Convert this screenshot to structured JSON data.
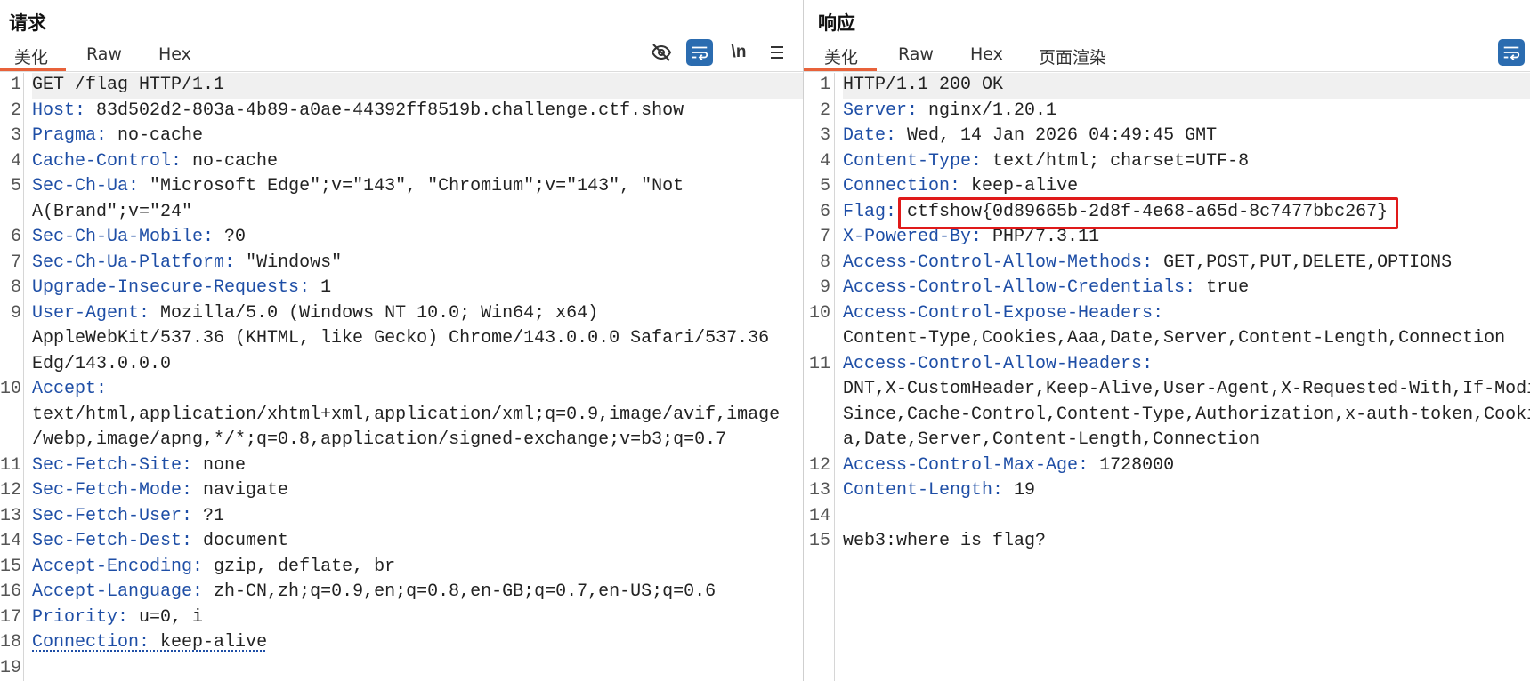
{
  "request": {
    "title": "请求",
    "tabs": [
      "美化",
      "Raw",
      "Hex"
    ],
    "icons": [
      "eye-slash-icon",
      "wrap-lines-icon",
      "newline-toggle-icon",
      "menu-icon"
    ],
    "newline_label": "\\n",
    "lines": [
      {
        "n": "1",
        "text": "GET /flag HTTP/1.1"
      },
      {
        "n": "2",
        "key": "Host",
        "sep": ": ",
        "value": "83d502d2-803a-4b89-a0ae-44392ff8519b.challenge.ctf.show"
      },
      {
        "n": "3",
        "key": "Pragma",
        "sep": ": ",
        "value": "no-cache"
      },
      {
        "n": "4",
        "key": "Cache-Control",
        "sep": ": ",
        "value": "no-cache"
      },
      {
        "n": "5",
        "key": "Sec-Ch-Ua",
        "sep": ": ",
        "value": "\"Microsoft Edge\";v=\"143\", \"Chromium\";v=\"143\", \"Not"
      },
      {
        "n": "",
        "text": "A(Brand\";v=\"24\""
      },
      {
        "n": "6",
        "key": "Sec-Ch-Ua-Mobile",
        "sep": ": ",
        "value": "?0"
      },
      {
        "n": "7",
        "key": "Sec-Ch-Ua-Platform",
        "sep": ": ",
        "value": "\"Windows\""
      },
      {
        "n": "8",
        "key": "Upgrade-Insecure-Requests",
        "sep": ": ",
        "value": "1"
      },
      {
        "n": "9",
        "key": "User-Agent",
        "sep": ": ",
        "value": "Mozilla/5.0 (Windows NT 10.0; Win64; x64)"
      },
      {
        "n": "",
        "text": "AppleWebKit/537.36 (KHTML, like Gecko) Chrome/143.0.0.0 Safari/537.36"
      },
      {
        "n": "",
        "text": "Edg/143.0.0.0"
      },
      {
        "n": "10",
        "key": "Accept",
        "sep": ":",
        "value": ""
      },
      {
        "n": "",
        "text": "text/html,application/xhtml+xml,application/xml;q=0.9,image/avif,image"
      },
      {
        "n": "",
        "text": "/webp,image/apng,*/*;q=0.8,application/signed-exchange;v=b3;q=0.7"
      },
      {
        "n": "11",
        "key": "Sec-Fetch-Site",
        "sep": ": ",
        "value": "none"
      },
      {
        "n": "12",
        "key": "Sec-Fetch-Mode",
        "sep": ": ",
        "value": "navigate"
      },
      {
        "n": "13",
        "key": "Sec-Fetch-User",
        "sep": ": ",
        "value": "?1"
      },
      {
        "n": "14",
        "key": "Sec-Fetch-Dest",
        "sep": ": ",
        "value": "document"
      },
      {
        "n": "15",
        "key": "Accept-Encoding",
        "sep": ": ",
        "value": "gzip, deflate, br"
      },
      {
        "n": "16",
        "key": "Accept-Language",
        "sep": ": ",
        "value": "zh-CN,zh;q=0.9,en;q=0.8,en-GB;q=0.7,en-US;q=0.6"
      },
      {
        "n": "17",
        "key": "Priority",
        "sep": ": ",
        "value": "u=0, i"
      },
      {
        "n": "18",
        "key": "Connection",
        "sep": ": ",
        "value": "keep-alive",
        "wavy": true
      },
      {
        "n": "19",
        "text": ""
      }
    ]
  },
  "response": {
    "title": "响应",
    "tabs": [
      "美化",
      "Raw",
      "Hex",
      "页面渲染"
    ],
    "icons": [
      "wrap-lines-icon"
    ],
    "lines": [
      {
        "n": "1",
        "text": "HTTP/1.1 200 OK"
      },
      {
        "n": "2",
        "key": "Server",
        "sep": ": ",
        "value": "nginx/1.20.1"
      },
      {
        "n": "3",
        "key": "Date",
        "sep": ": ",
        "value": "Wed, 14 Jan 2026 04:49:45 GMT"
      },
      {
        "n": "4",
        "key": "Content-Type",
        "sep": ": ",
        "value": "text/html; charset=UTF-8"
      },
      {
        "n": "5",
        "key": "Connection",
        "sep": ": ",
        "value": "keep-alive"
      },
      {
        "n": "6",
        "key": "Flag",
        "sep": ": ",
        "value": "ctfshow{0d89665b-2d8f-4e68-a65d-8c7477bbc267}",
        "highlight": true
      },
      {
        "n": "7",
        "key": "X-Powered-By",
        "sep": ": ",
        "value": "PHP/7.3.11"
      },
      {
        "n": "8",
        "key": "Access-Control-Allow-Methods",
        "sep": ": ",
        "value": "GET,POST,PUT,DELETE,OPTIONS"
      },
      {
        "n": "9",
        "key": "Access-Control-Allow-Credentials",
        "sep": ": ",
        "value": "true"
      },
      {
        "n": "10",
        "key": "Access-Control-Expose-Headers",
        "sep": ":",
        "value": ""
      },
      {
        "n": "",
        "text": "Content-Type,Cookies,Aaa,Date,Server,Content-Length,Connection"
      },
      {
        "n": "11",
        "key": "Access-Control-Allow-Headers",
        "sep": ":",
        "value": ""
      },
      {
        "n": "",
        "text": "DNT,X-CustomHeader,Keep-Alive,User-Agent,X-Requested-With,If-Modified-"
      },
      {
        "n": "",
        "text": "Since,Cache-Control,Content-Type,Authorization,x-auth-token,Cookies,Aa"
      },
      {
        "n": "",
        "text": "a,Date,Server,Content-Length,Connection"
      },
      {
        "n": "12",
        "key": "Access-Control-Max-Age",
        "sep": ": ",
        "value": "1728000"
      },
      {
        "n": "13",
        "key": "Content-Length",
        "sep": ": ",
        "value": "19"
      },
      {
        "n": "14",
        "text": ""
      },
      {
        "n": "15",
        "text": "web3:where is flag?"
      }
    ]
  }
}
